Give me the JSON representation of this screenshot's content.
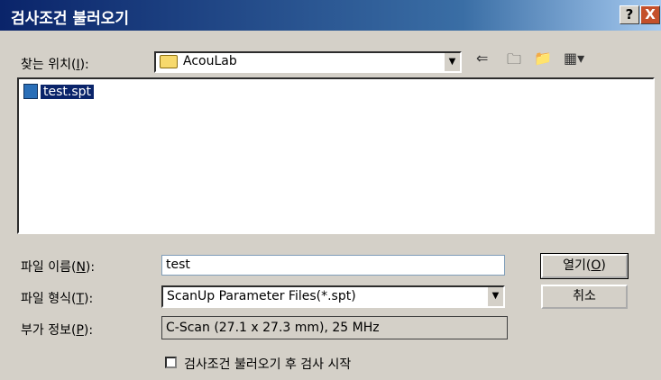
{
  "window": {
    "title": "검사조건 불러오기",
    "help_glyph": "?",
    "close_glyph": "X"
  },
  "lookin": {
    "label_pre": "찾는 위치(",
    "label_key": "I",
    "label_post": "):",
    "value": "AcouLab"
  },
  "toolbar": {
    "back": "⇐",
    "up": "🗀",
    "newfolder": "📁",
    "view": "▦▾"
  },
  "files": [
    {
      "name": "test.spt",
      "selected": true
    }
  ],
  "filename": {
    "label_pre": "파일 이름(",
    "label_key": "N",
    "label_post": "):",
    "value": "test"
  },
  "filetype": {
    "label_pre": "파일 형식(",
    "label_key": "T",
    "label_post": "):",
    "value": "ScanUp Parameter Files(*.spt)"
  },
  "extra": {
    "label_pre": "부가 정보(",
    "label_key": "P",
    "label_post": "):",
    "value": "C-Scan (27.1 x 27.3 mm), 25 MHz"
  },
  "buttons": {
    "open_pre": "열기(",
    "open_key": "O",
    "open_post": ")",
    "cancel": "취소"
  },
  "checkbox": {
    "label": "검사조건 불러오기 후 검사 시작",
    "checked": false
  }
}
